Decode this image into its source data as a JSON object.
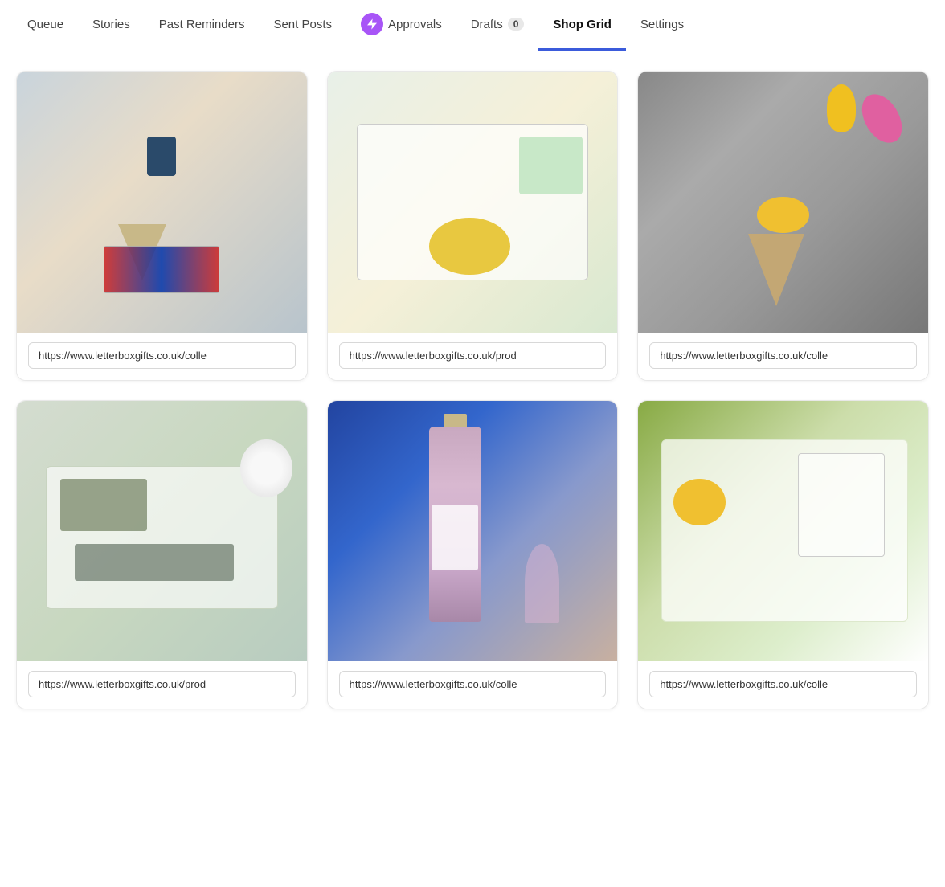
{
  "nav": {
    "items": [
      {
        "id": "queue",
        "label": "Queue",
        "active": false,
        "badge": null,
        "icon": null
      },
      {
        "id": "stories",
        "label": "Stories",
        "active": false,
        "badge": null,
        "icon": null
      },
      {
        "id": "past-reminders",
        "label": "Past Reminders",
        "active": false,
        "badge": null,
        "icon": null
      },
      {
        "id": "sent-posts",
        "label": "Sent Posts",
        "active": false,
        "badge": null,
        "icon": null
      },
      {
        "id": "approvals",
        "label": "Approvals",
        "active": false,
        "badge": null,
        "icon": "lightning"
      },
      {
        "id": "drafts",
        "label": "Drafts",
        "active": false,
        "badge": "0",
        "icon": null
      },
      {
        "id": "shop-grid",
        "label": "Shop Grid",
        "active": true,
        "badge": null,
        "icon": null
      },
      {
        "id": "settings",
        "label": "Settings",
        "active": false,
        "badge": null,
        "icon": null
      }
    ]
  },
  "grid": {
    "cards": [
      {
        "id": "card-1",
        "img_class": "img-1",
        "url": "https://www.letterboxgifts.co.uk/colle"
      },
      {
        "id": "card-2",
        "img_class": "img-2",
        "url": "https://www.letterboxgifts.co.uk/prod"
      },
      {
        "id": "card-3",
        "img_class": "img-3",
        "url": "https://www.letterboxgifts.co.uk/colle"
      },
      {
        "id": "card-4",
        "img_class": "img-4",
        "url": "https://www.letterboxgifts.co.uk/prod"
      },
      {
        "id": "card-5",
        "img_class": "img-5",
        "url": "https://www.letterboxgifts.co.uk/colle"
      },
      {
        "id": "card-6",
        "img_class": "img-6",
        "url": "https://www.letterboxgifts.co.uk/colle"
      }
    ]
  }
}
